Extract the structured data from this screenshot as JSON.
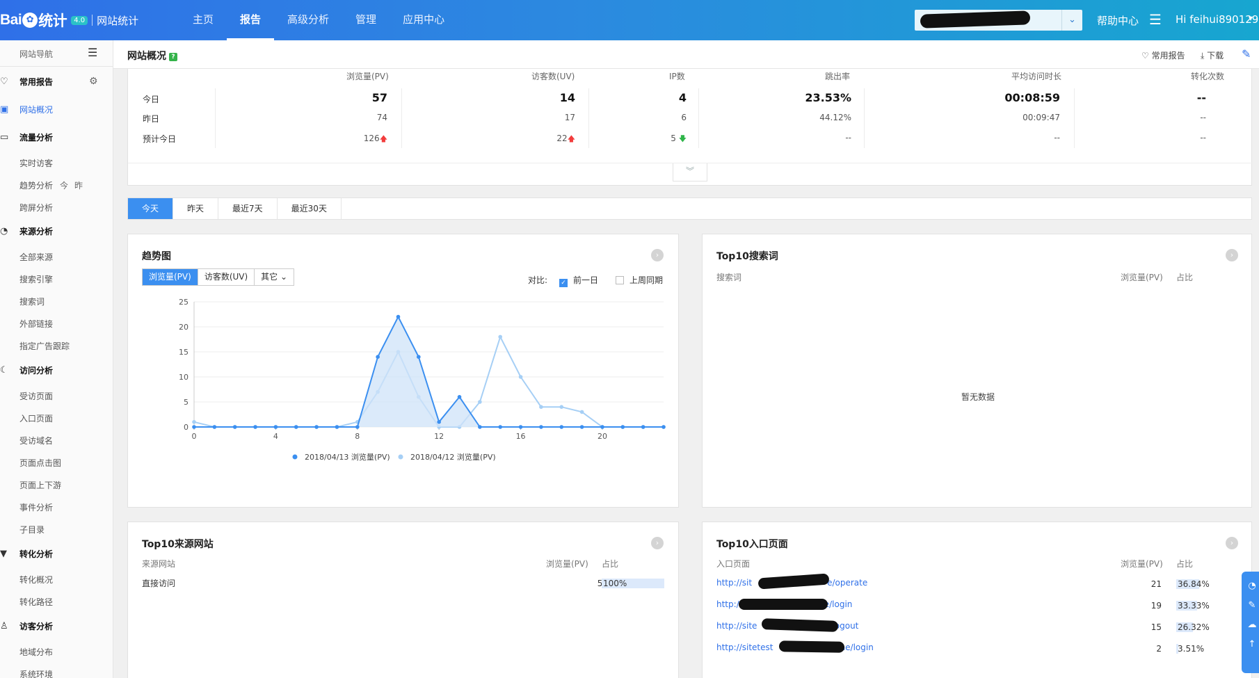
{
  "topbar": {
    "logo_text_a": "Bai",
    "logo_paw": "✿",
    "logo_text_b": "统计",
    "badge": "4.0",
    "subtitle": "网站统计",
    "nav": [
      "主页",
      "报告",
      "高级分析",
      "管理",
      "应用中心"
    ],
    "active_nav": "报告",
    "help": "帮助中心",
    "greeting": "Hi  feihui890129"
  },
  "sidebar": {
    "header": "网站导航",
    "favorites": "常用报告",
    "overview": "网站概况",
    "traffic": "流量分析",
    "traffic_items": [
      "实时访客",
      "趋势分析",
      "跨屏分析"
    ],
    "trend_today": "今",
    "trend_yesterday": "昨",
    "source": "来源分析",
    "source_items": [
      "全部来源",
      "搜索引擎",
      "搜索词",
      "外部链接",
      "指定广告跟踪"
    ],
    "visit": "访问分析",
    "visit_items": [
      "受访页面",
      "入口页面",
      "受访域名",
      "页面点击图",
      "页面上下游",
      "事件分析",
      "子目录"
    ],
    "conversion": "转化分析",
    "conversion_items": [
      "转化概况",
      "转化路径"
    ],
    "visitor": "访客分析",
    "visitor_items": [
      "地域分布",
      "系统环境"
    ]
  },
  "header": {
    "title": "网站概况",
    "q": "?",
    "favorite": "常用报告",
    "download": "下载"
  },
  "summary": {
    "columns": [
      "浏览量(PV)",
      "访客数(UV)",
      "IP数",
      "跳出率",
      "平均访问时长",
      "转化次数"
    ],
    "row_labels": [
      "今日",
      "昨日",
      "预计今日"
    ],
    "today": [
      "57",
      "14",
      "4",
      "23.53%",
      "00:08:59",
      "--"
    ],
    "yesterday": [
      "74",
      "17",
      "6",
      "44.12%",
      "00:09:47",
      "--"
    ],
    "forecast": [
      "126",
      "22",
      "5",
      "--",
      "--",
      "--"
    ],
    "forecast_trend": [
      "up",
      "up",
      "down"
    ]
  },
  "tabs": [
    "今天",
    "昨天",
    "最近7天",
    "最近30天"
  ],
  "trend": {
    "title": "趋势图",
    "metrics": [
      "浏览量(PV)",
      "访客数(UV)",
      "其它"
    ],
    "compare_label": "对比:",
    "compare_options": [
      "前一日",
      "上周同期"
    ],
    "compare_checked": [
      true,
      false
    ]
  },
  "chart_data": {
    "type": "area",
    "x": [
      0,
      1,
      2,
      3,
      4,
      5,
      6,
      7,
      8,
      9,
      10,
      11,
      12,
      13,
      14,
      15,
      16,
      17,
      18,
      19,
      20,
      21,
      22,
      23
    ],
    "xticks": [
      0,
      4,
      8,
      12,
      16,
      20
    ],
    "yticks": [
      0,
      5,
      10,
      15,
      20,
      25
    ],
    "ylim": [
      0,
      25
    ],
    "series": [
      {
        "name": "2018/04/13 浏览量(PV)",
        "color": "#3b8ff0",
        "values": [
          0,
          0,
          0,
          0,
          0,
          0,
          0,
          0,
          0,
          14,
          22,
          14,
          1,
          6,
          0,
          0,
          0,
          0,
          0,
          0,
          0,
          0,
          0,
          0
        ]
      },
      {
        "name": "2018/04/12 浏览量(PV)",
        "color": "#a6cff5",
        "values": [
          1,
          0,
          0,
          0,
          0,
          0,
          0,
          0,
          1,
          7,
          15,
          6,
          0,
          0,
          5,
          18,
          10,
          4,
          4,
          3,
          0,
          0,
          0,
          0
        ]
      }
    ]
  },
  "top_search": {
    "title": "Top10搜索词",
    "columns": [
      "搜索词",
      "浏览量(PV)",
      "占比"
    ],
    "empty": "暂无数据"
  },
  "top_source": {
    "title": "Top10来源网站",
    "columns": [
      "来源网站",
      "浏览量(PV)",
      "占比"
    ],
    "rows": [
      {
        "name": "直接访问",
        "pv": "57",
        "pct": "100%",
        "frac": 1.0
      }
    ]
  },
  "top_entry": {
    "title": "Top10入口页面",
    "columns": [
      "入口页面",
      "浏览量(PV)",
      "占比"
    ],
    "rows": [
      {
        "pre": "http://sit",
        "post": "e/operate",
        "pv": "21",
        "pct": "36.84%",
        "frac": 0.3684
      },
      {
        "pre": "http:/",
        "post": "e/login",
        "pv": "19",
        "pct": "33.33%",
        "frac": 0.3333
      },
      {
        "pre": "http://site",
        "post": "logout",
        "pv": "15",
        "pct": "26.32%",
        "frac": 0.2632
      },
      {
        "pre": "http://sitetest",
        "post": "me/login",
        "pv": "2",
        "pct": "3.51%",
        "frac": 0.0351
      }
    ]
  },
  "colors": {
    "accent": "#3b8ff0",
    "up": "#f23c3c",
    "down": "#2fb54a"
  }
}
